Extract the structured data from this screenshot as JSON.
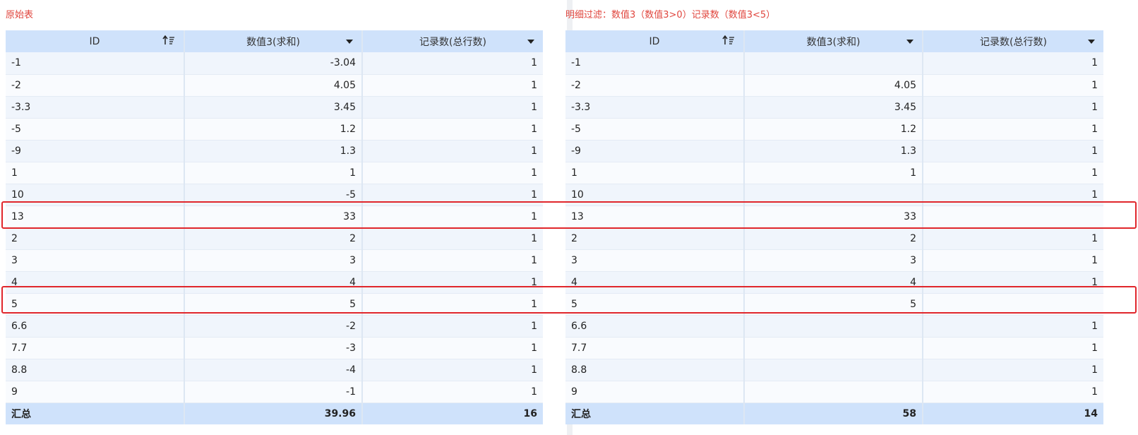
{
  "left": {
    "title": "原始表",
    "headers": [
      "ID",
      "数值3(求和)",
      "记录数(总行数)"
    ],
    "rows": [
      [
        "-1",
        "-3.04",
        "1"
      ],
      [
        "-2",
        "4.05",
        "1"
      ],
      [
        "-3.3",
        "3.45",
        "1"
      ],
      [
        "-5",
        "1.2",
        "1"
      ],
      [
        "-9",
        "1.3",
        "1"
      ],
      [
        "1",
        "1",
        "1"
      ],
      [
        "10",
        "-5",
        "1"
      ],
      [
        "13",
        "33",
        "1"
      ],
      [
        "2",
        "2",
        "1"
      ],
      [
        "3",
        "3",
        "1"
      ],
      [
        "4",
        "4",
        "1"
      ],
      [
        "5",
        "5",
        "1"
      ],
      [
        "6.6",
        "-2",
        "1"
      ],
      [
        "7.7",
        "-3",
        "1"
      ],
      [
        "8.8",
        "-4",
        "1"
      ],
      [
        "9",
        "-1",
        "1"
      ]
    ],
    "footer": [
      "汇总",
      "39.96",
      "16"
    ]
  },
  "right": {
    "title": "明细过滤：数值3（数值3>0）记录数（数值3<5）",
    "headers": [
      "ID",
      "数值3(求和)",
      "记录数(总行数)"
    ],
    "rows": [
      [
        "-1",
        "",
        "1"
      ],
      [
        "-2",
        "4.05",
        "1"
      ],
      [
        "-3.3",
        "3.45",
        "1"
      ],
      [
        "-5",
        "1.2",
        "1"
      ],
      [
        "-9",
        "1.3",
        "1"
      ],
      [
        "1",
        "1",
        "1"
      ],
      [
        "10",
        "",
        "1"
      ],
      [
        "13",
        "33",
        ""
      ],
      [
        "2",
        "2",
        "1"
      ],
      [
        "3",
        "3",
        "1"
      ],
      [
        "4",
        "4",
        "1"
      ],
      [
        "5",
        "5",
        ""
      ],
      [
        "6.6",
        "",
        "1"
      ],
      [
        "7.7",
        "",
        "1"
      ],
      [
        "8.8",
        "",
        "1"
      ],
      [
        "9",
        "",
        "1"
      ]
    ],
    "footer": [
      "汇总",
      "58",
      "14"
    ]
  },
  "icons": {
    "sort": "sort-ascending-icon",
    "dropdown": "caret-down-icon"
  },
  "colors": {
    "header_bg": "#cfe2fb",
    "title": "#e0463e",
    "highlight": "#e0262b"
  }
}
